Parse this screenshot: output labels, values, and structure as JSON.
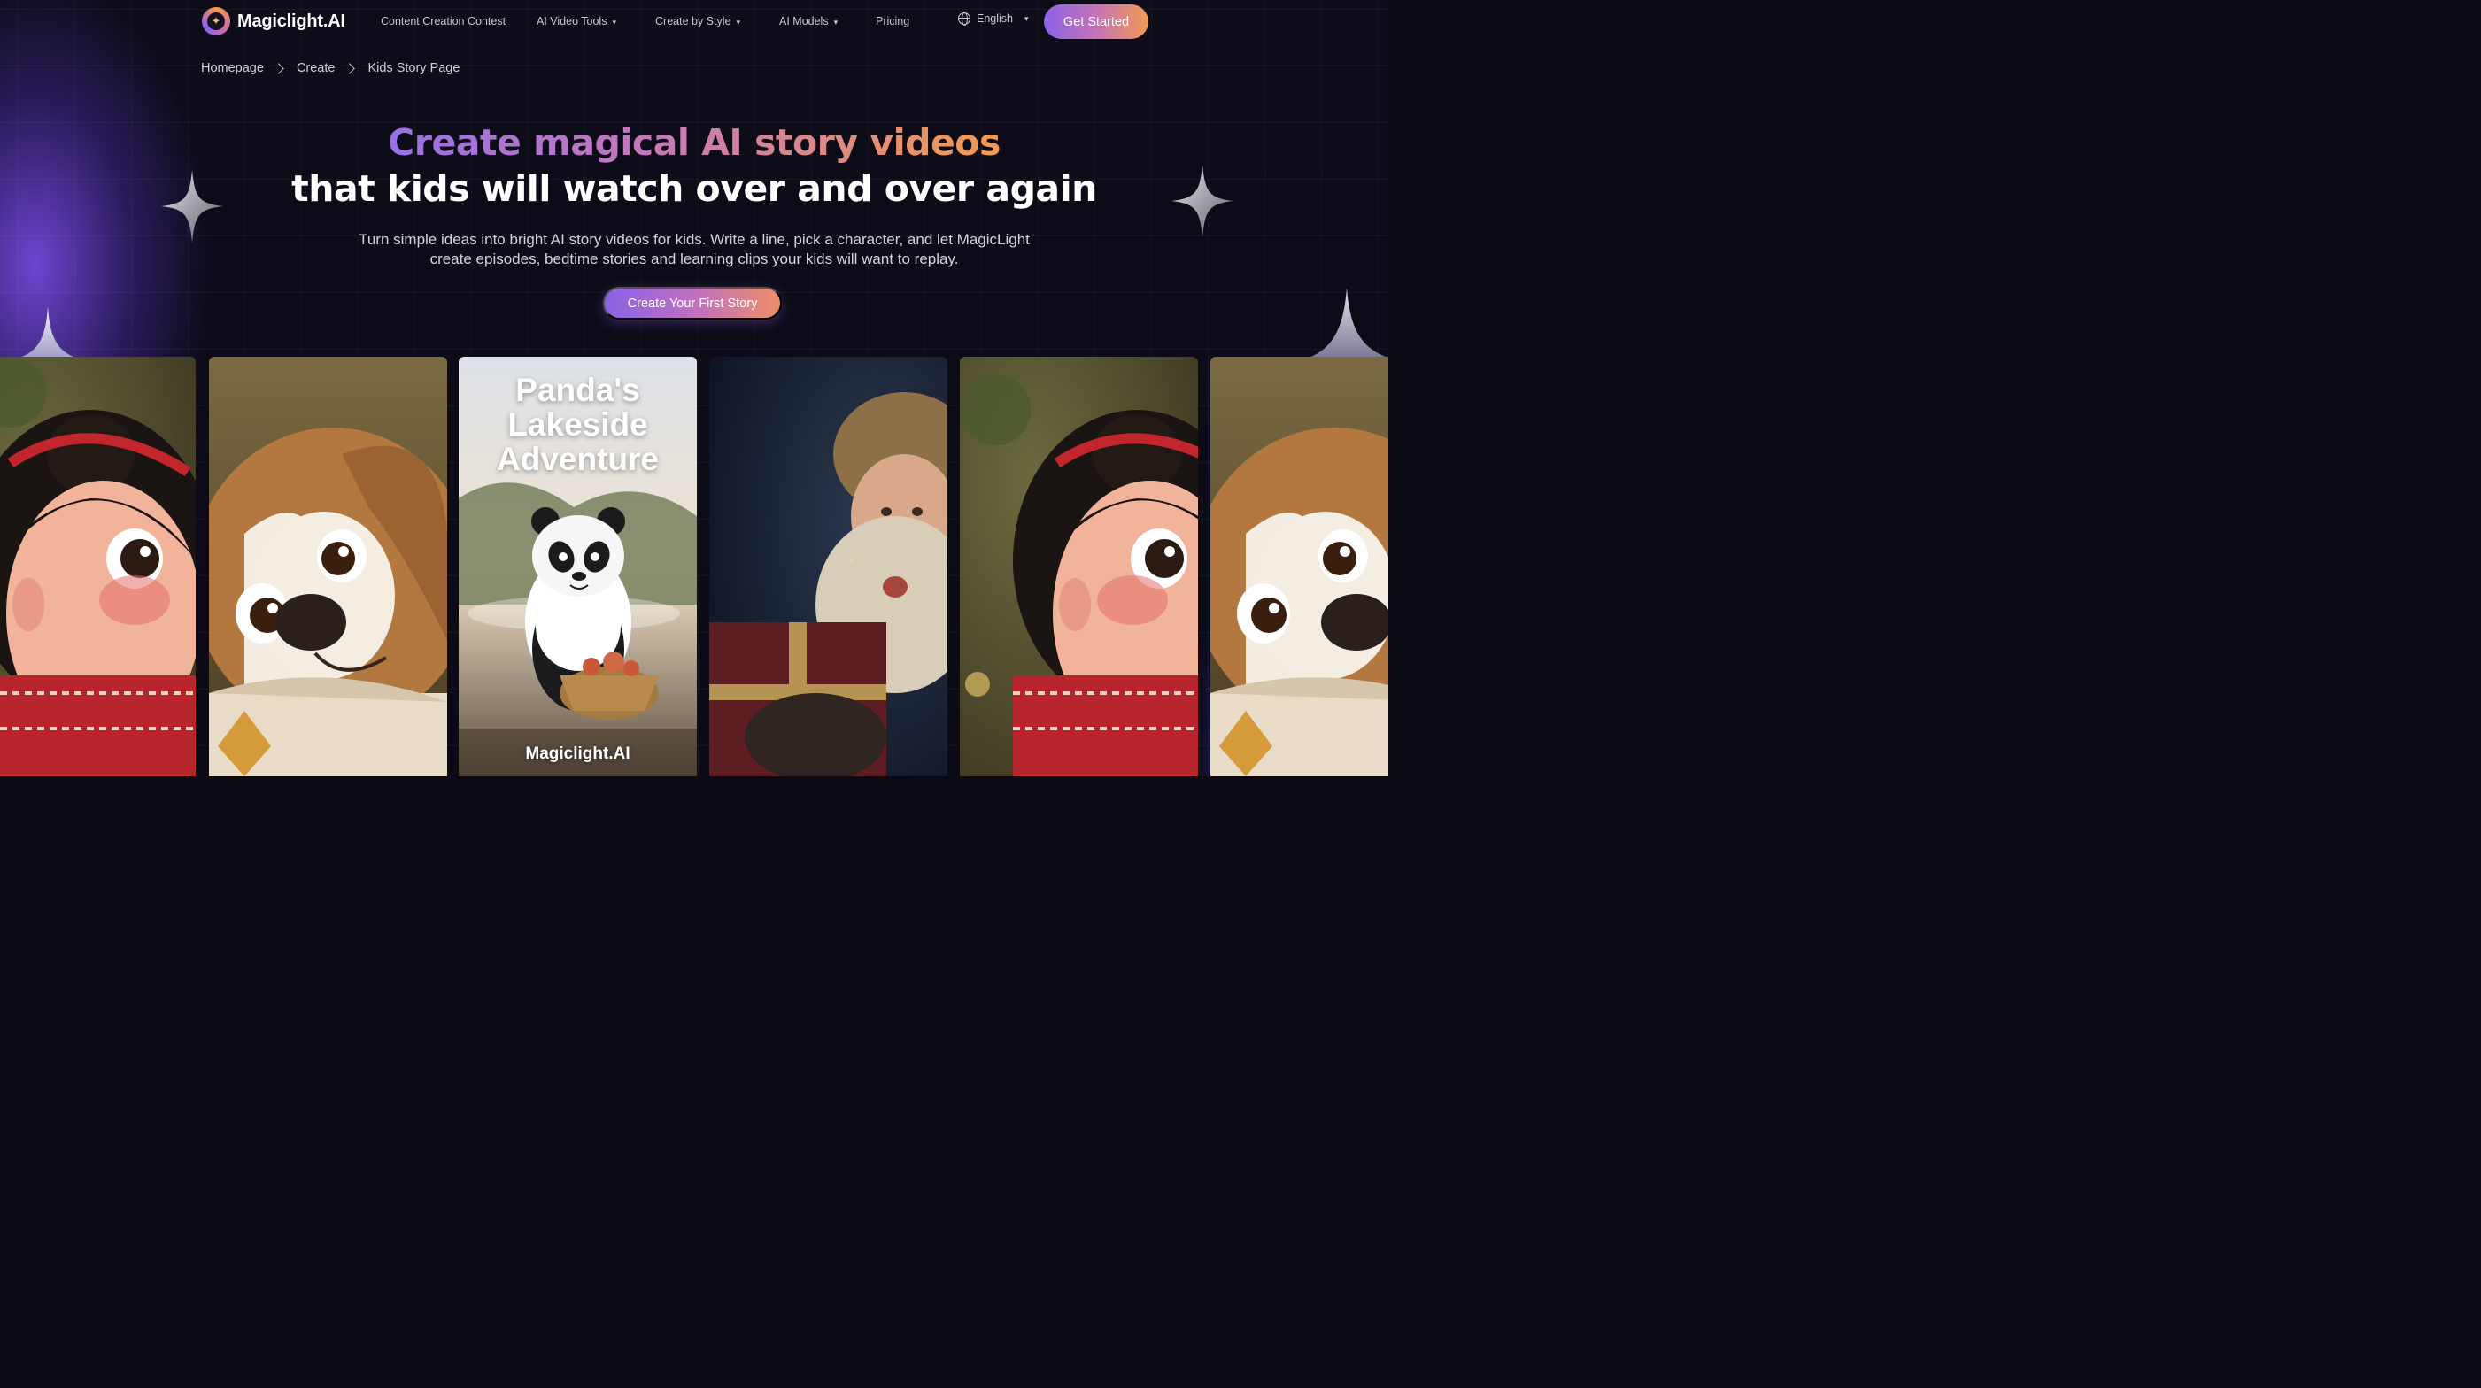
{
  "brand": {
    "name": "Magiclight.AI",
    "logo_icon": "sparkle-logo-icon"
  },
  "nav": {
    "items": [
      {
        "label": "Content Creation Contest",
        "dropdown": false
      },
      {
        "label": "AI Video Tools",
        "dropdown": true
      },
      {
        "label": "Create by Style",
        "dropdown": true
      },
      {
        "label": "AI Models",
        "dropdown": true
      },
      {
        "label": "Pricing",
        "dropdown": false
      }
    ],
    "language": "English",
    "cta": "Get Started"
  },
  "breadcrumb": [
    "Homepage",
    "Create",
    "Kids Story Page"
  ],
  "hero": {
    "headline_gradient": "Create magical AI story videos",
    "headline_plain": "that kids will watch over and over again",
    "subtitle": "Turn simple ideas into bright AI story videos for kids. Write a line, pick a character, and let MagicLight create episodes, bedtime stories and learning clips your kids will want to replay.",
    "cta": "Create Your First Story"
  },
  "gallery": {
    "cards": [
      {
        "subject": "girl-character"
      },
      {
        "subject": "puppy-character"
      },
      {
        "subject": "panda-poster",
        "title": "Panda's Lakeside Adventure",
        "brand": "Magiclight.AI"
      },
      {
        "subject": "santa-with-gift"
      },
      {
        "subject": "girl-character"
      },
      {
        "subject": "puppy-character"
      }
    ]
  },
  "colors": {
    "accent_purple": "#8b62e6",
    "accent_pink": "#c672b8",
    "accent_orange": "#f39a52",
    "background": "#0b0a14"
  }
}
